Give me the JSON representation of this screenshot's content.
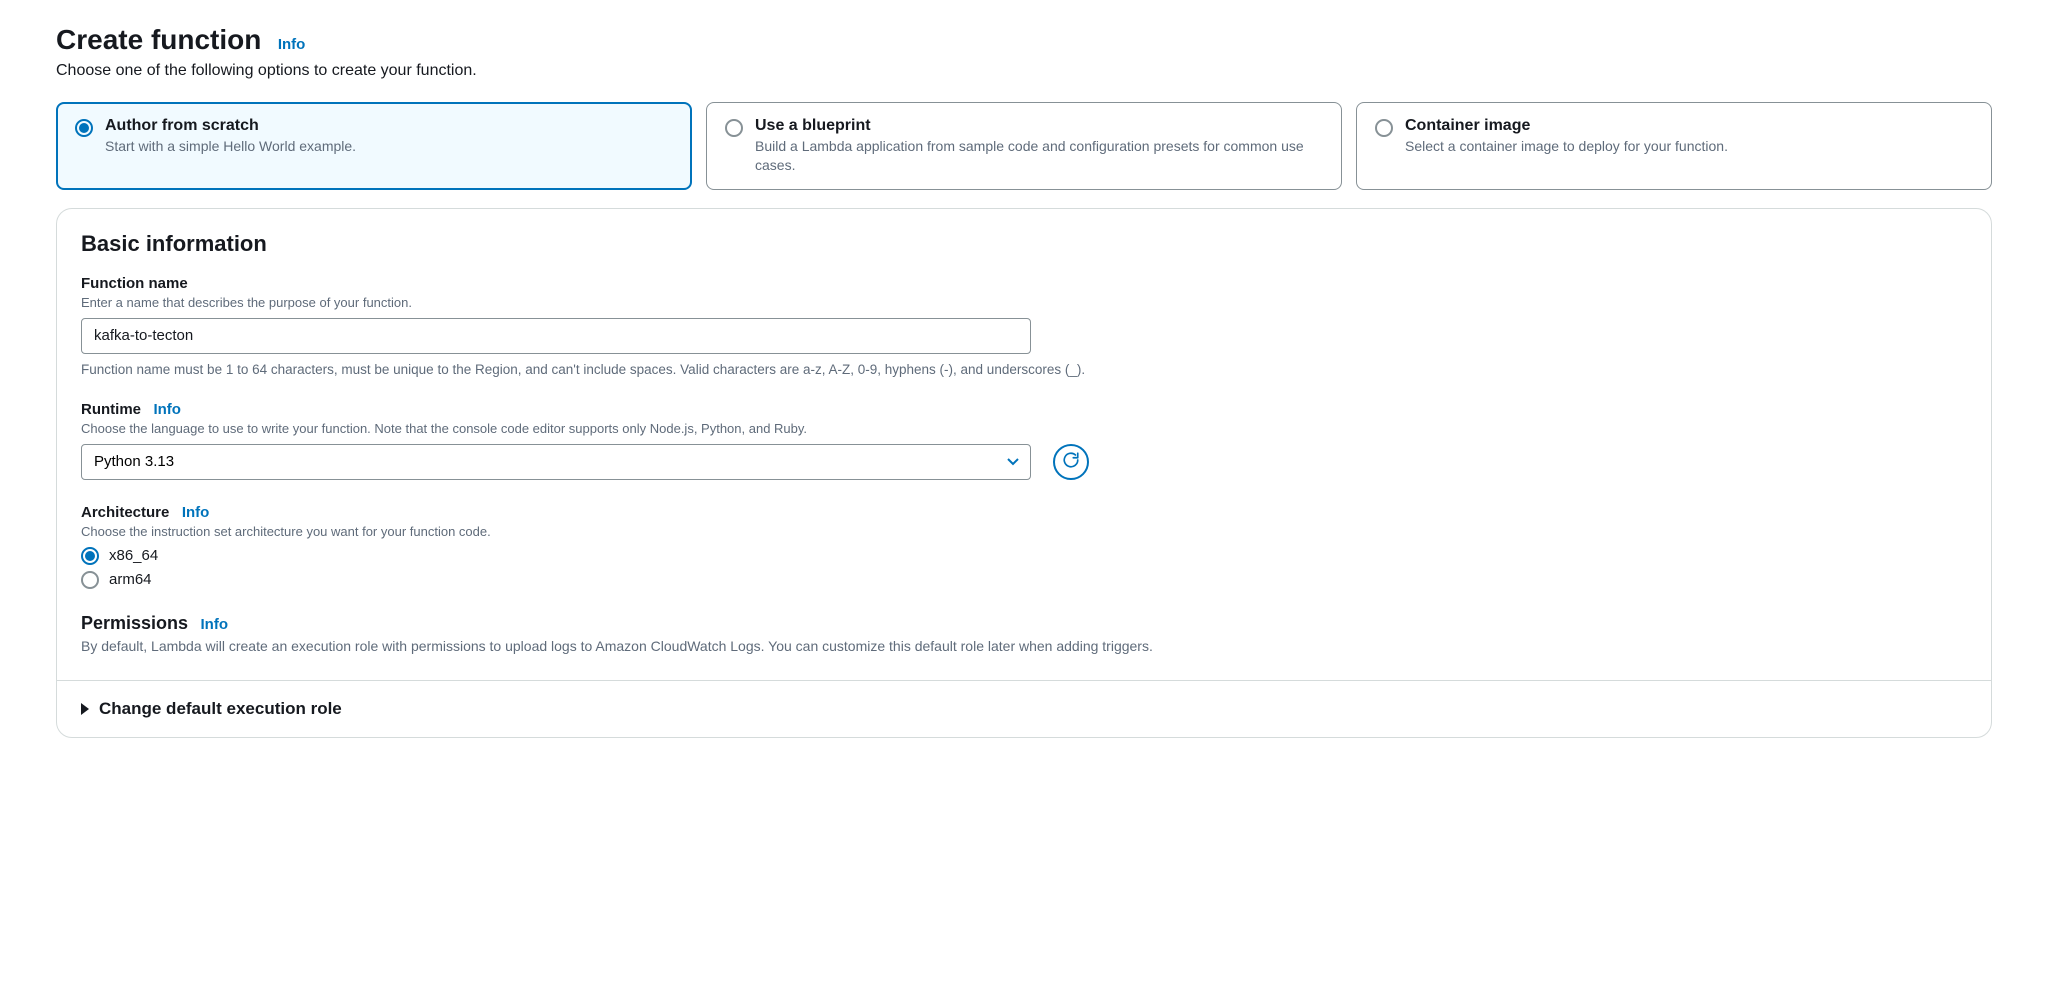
{
  "header": {
    "title": "Create function",
    "info": "Info",
    "subtitle": "Choose one of the following options to create your function."
  },
  "options": [
    {
      "title": "Author from scratch",
      "desc": "Start with a simple Hello World example.",
      "selected": true
    },
    {
      "title": "Use a blueprint",
      "desc": "Build a Lambda application from sample code and configuration presets for common use cases.",
      "selected": false
    },
    {
      "title": "Container image",
      "desc": "Select a container image to deploy for your function.",
      "selected": false
    }
  ],
  "basic": {
    "section_title": "Basic information",
    "function_name": {
      "label": "Function name",
      "hint": "Enter a name that describes the purpose of your function.",
      "value": "kafka-to-tecton",
      "help": "Function name must be 1 to 64 characters, must be unique to the Region, and can't include spaces. Valid characters are a-z, A-Z, 0-9, hyphens (-), and underscores (_)."
    },
    "runtime": {
      "label": "Runtime",
      "info": "Info",
      "hint": "Choose the language to use to write your function. Note that the console code editor supports only Node.js, Python, and Ruby.",
      "value": "Python 3.13"
    },
    "architecture": {
      "label": "Architecture",
      "info": "Info",
      "hint": "Choose the instruction set architecture you want for your function code.",
      "choices": [
        {
          "label": "x86_64",
          "selected": true
        },
        {
          "label": "arm64",
          "selected": false
        }
      ]
    },
    "permissions": {
      "title": "Permissions",
      "info": "Info",
      "desc": "By default, Lambda will create an execution role with permissions to upload logs to Amazon CloudWatch Logs. You can customize this default role later when adding triggers."
    },
    "expander": {
      "title": "Change default execution role"
    }
  }
}
